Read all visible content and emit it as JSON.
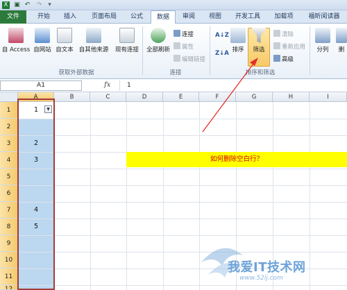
{
  "tabs": [
    "文件",
    "开始",
    "插入",
    "页面布局",
    "公式",
    "数据",
    "审阅",
    "视图",
    "开发工具",
    "加载项",
    "福昕阅读器"
  ],
  "ribbon": {
    "external": {
      "access": "自 Access",
      "web": "自网站",
      "text": "自文本",
      "other": "自其他来源",
      "existing": "现有连接",
      "group": "获取外部数据"
    },
    "connections": {
      "refresh": "全部刷新",
      "connect": "连接",
      "props": "属性",
      "edit_links": "编辑链接",
      "group": "连接"
    },
    "sort_filter": {
      "sort": "排序",
      "filter": "筛选",
      "clear": "清除",
      "reapply": "重新应用",
      "advanced": "高级",
      "group": "排序和筛选"
    },
    "tools": {
      "split": "分列",
      "remove": "删"
    }
  },
  "formula_bar": {
    "name_box": "A1",
    "fx": "fx",
    "value": "1"
  },
  "columns": [
    "A",
    "B",
    "C",
    "D",
    "E",
    "F",
    "G",
    "H",
    "I"
  ],
  "rows": [
    "1",
    "2",
    "3",
    "4",
    "5",
    "6",
    "7",
    "8",
    "9",
    "10",
    "11",
    "12"
  ],
  "cells_a": [
    "1",
    "",
    "2",
    "3",
    "",
    "",
    "4",
    "5",
    "",
    "",
    "",
    ""
  ],
  "note": "如何删除空白行？",
  "watermark": {
    "text": "我爱IT技术网",
    "url": "www.52ij.com"
  }
}
